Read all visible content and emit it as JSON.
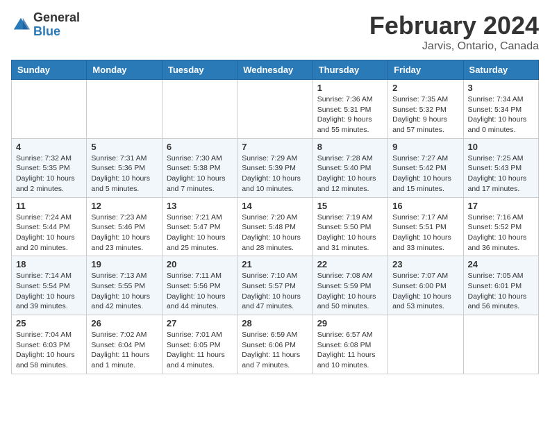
{
  "header": {
    "logo_general": "General",
    "logo_blue": "Blue",
    "month": "February 2024",
    "location": "Jarvis, Ontario, Canada"
  },
  "weekdays": [
    "Sunday",
    "Monday",
    "Tuesday",
    "Wednesday",
    "Thursday",
    "Friday",
    "Saturday"
  ],
  "weeks": [
    [
      {
        "day": "",
        "info": ""
      },
      {
        "day": "",
        "info": ""
      },
      {
        "day": "",
        "info": ""
      },
      {
        "day": "",
        "info": ""
      },
      {
        "day": "1",
        "info": "Sunrise: 7:36 AM\nSunset: 5:31 PM\nDaylight: 9 hours and 55 minutes."
      },
      {
        "day": "2",
        "info": "Sunrise: 7:35 AM\nSunset: 5:32 PM\nDaylight: 9 hours and 57 minutes."
      },
      {
        "day": "3",
        "info": "Sunrise: 7:34 AM\nSunset: 5:34 PM\nDaylight: 10 hours and 0 minutes."
      }
    ],
    [
      {
        "day": "4",
        "info": "Sunrise: 7:32 AM\nSunset: 5:35 PM\nDaylight: 10 hours and 2 minutes."
      },
      {
        "day": "5",
        "info": "Sunrise: 7:31 AM\nSunset: 5:36 PM\nDaylight: 10 hours and 5 minutes."
      },
      {
        "day": "6",
        "info": "Sunrise: 7:30 AM\nSunset: 5:38 PM\nDaylight: 10 hours and 7 minutes."
      },
      {
        "day": "7",
        "info": "Sunrise: 7:29 AM\nSunset: 5:39 PM\nDaylight: 10 hours and 10 minutes."
      },
      {
        "day": "8",
        "info": "Sunrise: 7:28 AM\nSunset: 5:40 PM\nDaylight: 10 hours and 12 minutes."
      },
      {
        "day": "9",
        "info": "Sunrise: 7:27 AM\nSunset: 5:42 PM\nDaylight: 10 hours and 15 minutes."
      },
      {
        "day": "10",
        "info": "Sunrise: 7:25 AM\nSunset: 5:43 PM\nDaylight: 10 hours and 17 minutes."
      }
    ],
    [
      {
        "day": "11",
        "info": "Sunrise: 7:24 AM\nSunset: 5:44 PM\nDaylight: 10 hours and 20 minutes."
      },
      {
        "day": "12",
        "info": "Sunrise: 7:23 AM\nSunset: 5:46 PM\nDaylight: 10 hours and 23 minutes."
      },
      {
        "day": "13",
        "info": "Sunrise: 7:21 AM\nSunset: 5:47 PM\nDaylight: 10 hours and 25 minutes."
      },
      {
        "day": "14",
        "info": "Sunrise: 7:20 AM\nSunset: 5:48 PM\nDaylight: 10 hours and 28 minutes."
      },
      {
        "day": "15",
        "info": "Sunrise: 7:19 AM\nSunset: 5:50 PM\nDaylight: 10 hours and 31 minutes."
      },
      {
        "day": "16",
        "info": "Sunrise: 7:17 AM\nSunset: 5:51 PM\nDaylight: 10 hours and 33 minutes."
      },
      {
        "day": "17",
        "info": "Sunrise: 7:16 AM\nSunset: 5:52 PM\nDaylight: 10 hours and 36 minutes."
      }
    ],
    [
      {
        "day": "18",
        "info": "Sunrise: 7:14 AM\nSunset: 5:54 PM\nDaylight: 10 hours and 39 minutes."
      },
      {
        "day": "19",
        "info": "Sunrise: 7:13 AM\nSunset: 5:55 PM\nDaylight: 10 hours and 42 minutes."
      },
      {
        "day": "20",
        "info": "Sunrise: 7:11 AM\nSunset: 5:56 PM\nDaylight: 10 hours and 44 minutes."
      },
      {
        "day": "21",
        "info": "Sunrise: 7:10 AM\nSunset: 5:57 PM\nDaylight: 10 hours and 47 minutes."
      },
      {
        "day": "22",
        "info": "Sunrise: 7:08 AM\nSunset: 5:59 PM\nDaylight: 10 hours and 50 minutes."
      },
      {
        "day": "23",
        "info": "Sunrise: 7:07 AM\nSunset: 6:00 PM\nDaylight: 10 hours and 53 minutes."
      },
      {
        "day": "24",
        "info": "Sunrise: 7:05 AM\nSunset: 6:01 PM\nDaylight: 10 hours and 56 minutes."
      }
    ],
    [
      {
        "day": "25",
        "info": "Sunrise: 7:04 AM\nSunset: 6:03 PM\nDaylight: 10 hours and 58 minutes."
      },
      {
        "day": "26",
        "info": "Sunrise: 7:02 AM\nSunset: 6:04 PM\nDaylight: 11 hours and 1 minute."
      },
      {
        "day": "27",
        "info": "Sunrise: 7:01 AM\nSunset: 6:05 PM\nDaylight: 11 hours and 4 minutes."
      },
      {
        "day": "28",
        "info": "Sunrise: 6:59 AM\nSunset: 6:06 PM\nDaylight: 11 hours and 7 minutes."
      },
      {
        "day": "29",
        "info": "Sunrise: 6:57 AM\nSunset: 6:08 PM\nDaylight: 11 hours and 10 minutes."
      },
      {
        "day": "",
        "info": ""
      },
      {
        "day": "",
        "info": ""
      }
    ]
  ]
}
